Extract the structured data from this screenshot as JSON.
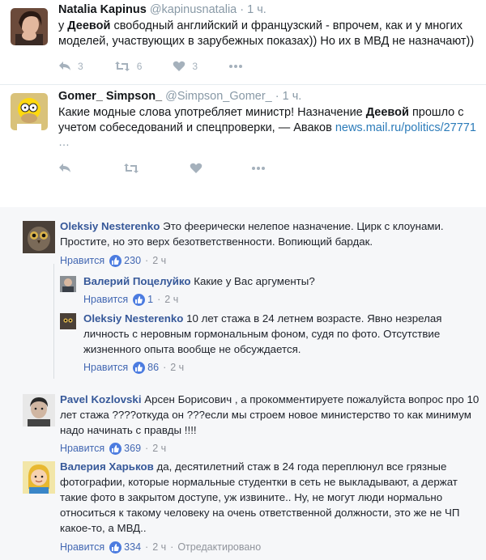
{
  "tweets": [
    {
      "name": "Natalia Kapinus",
      "handle": "@kapinusnatalia",
      "dot": "·",
      "time": "1 ч.",
      "text_pre": "у ",
      "text_bold": "Деевой",
      "text_post": " свободный английский и французский - впрочем, как и у многих моделей, участвующих в зарубежных показах)) Но их в МВД не назначают))",
      "replies": "3",
      "retweets": "6",
      "likes": "3",
      "avatar_icon": "user-avatar-icon"
    },
    {
      "name": "Gomer_ Simpson_",
      "handle": "@Simpson_Gomer_",
      "dot": "·",
      "time": "1 ч.",
      "text_pre": "Какие модные слова употребляет министр! Назначение ",
      "text_bold": "Деевой",
      "text_post": " прошло с учетом собеседований и спецпроверки, — Аваков ",
      "link": "news.mail.ru/politics/27771",
      "more": "…",
      "avatar_icon": "homer-avatar-icon"
    }
  ],
  "comments": [
    {
      "name": "Oleksiy Nesterenko",
      "text": "Это феерически нелепое назначение. Цирк с клоунами. Простите, но это верх безответственности. Вопиющий бардак.",
      "like_label": "Нравится",
      "likes": "230",
      "time": "2 ч",
      "dot": "·"
    },
    {
      "name": "Валерий Поцелуйко",
      "text": "Какие у Вас аргументы?",
      "like_label": "Нравится",
      "likes": "1",
      "time": "2 ч",
      "dot": "·"
    },
    {
      "name": "Oleksiy Nesterenko",
      "text": "10 лет стажа в 24 летнем возрасте. Явно незрелая личность с неровным гормональным фоном, судя по фото. Отсутствие жизненного опыта вообще не обсуждается.",
      "like_label": "Нравится",
      "likes": "86",
      "time": "2 ч",
      "dot": "·"
    },
    {
      "name": "Pavel Kozlovski",
      "text": "Арсен Борисович , а прокомментируете пожалуйста вопрос про 10 лет стажа ????откуда он ???если мы строем новое министерство то как минимум надо начинать с правды !!!!",
      "like_label": "Нравится",
      "likes": "369",
      "time": "2 ч",
      "dot": "·"
    },
    {
      "name": "Валерия Харьков",
      "text": "да, десятилетний стаж в 24 года переплюнул все грязные фотографии, которые нормальные студентки в сеть не выкладывают, а держат такие фото в закрытом доступе, уж извините.. Ну, не могут люди нормально относиться к такому человеку на очень ответственной должности, это же не ЧП какое-то, а МВД..",
      "like_label": "Нравится",
      "likes": "334",
      "time": "2 ч",
      "dot": "·",
      "edited": "Отредактировано"
    }
  ],
  "colors": {
    "fb_link": "#365899",
    "like_blue": "#4c7ce0",
    "twitter_link": "#2b7bb9",
    "muted": "#8899a6"
  }
}
